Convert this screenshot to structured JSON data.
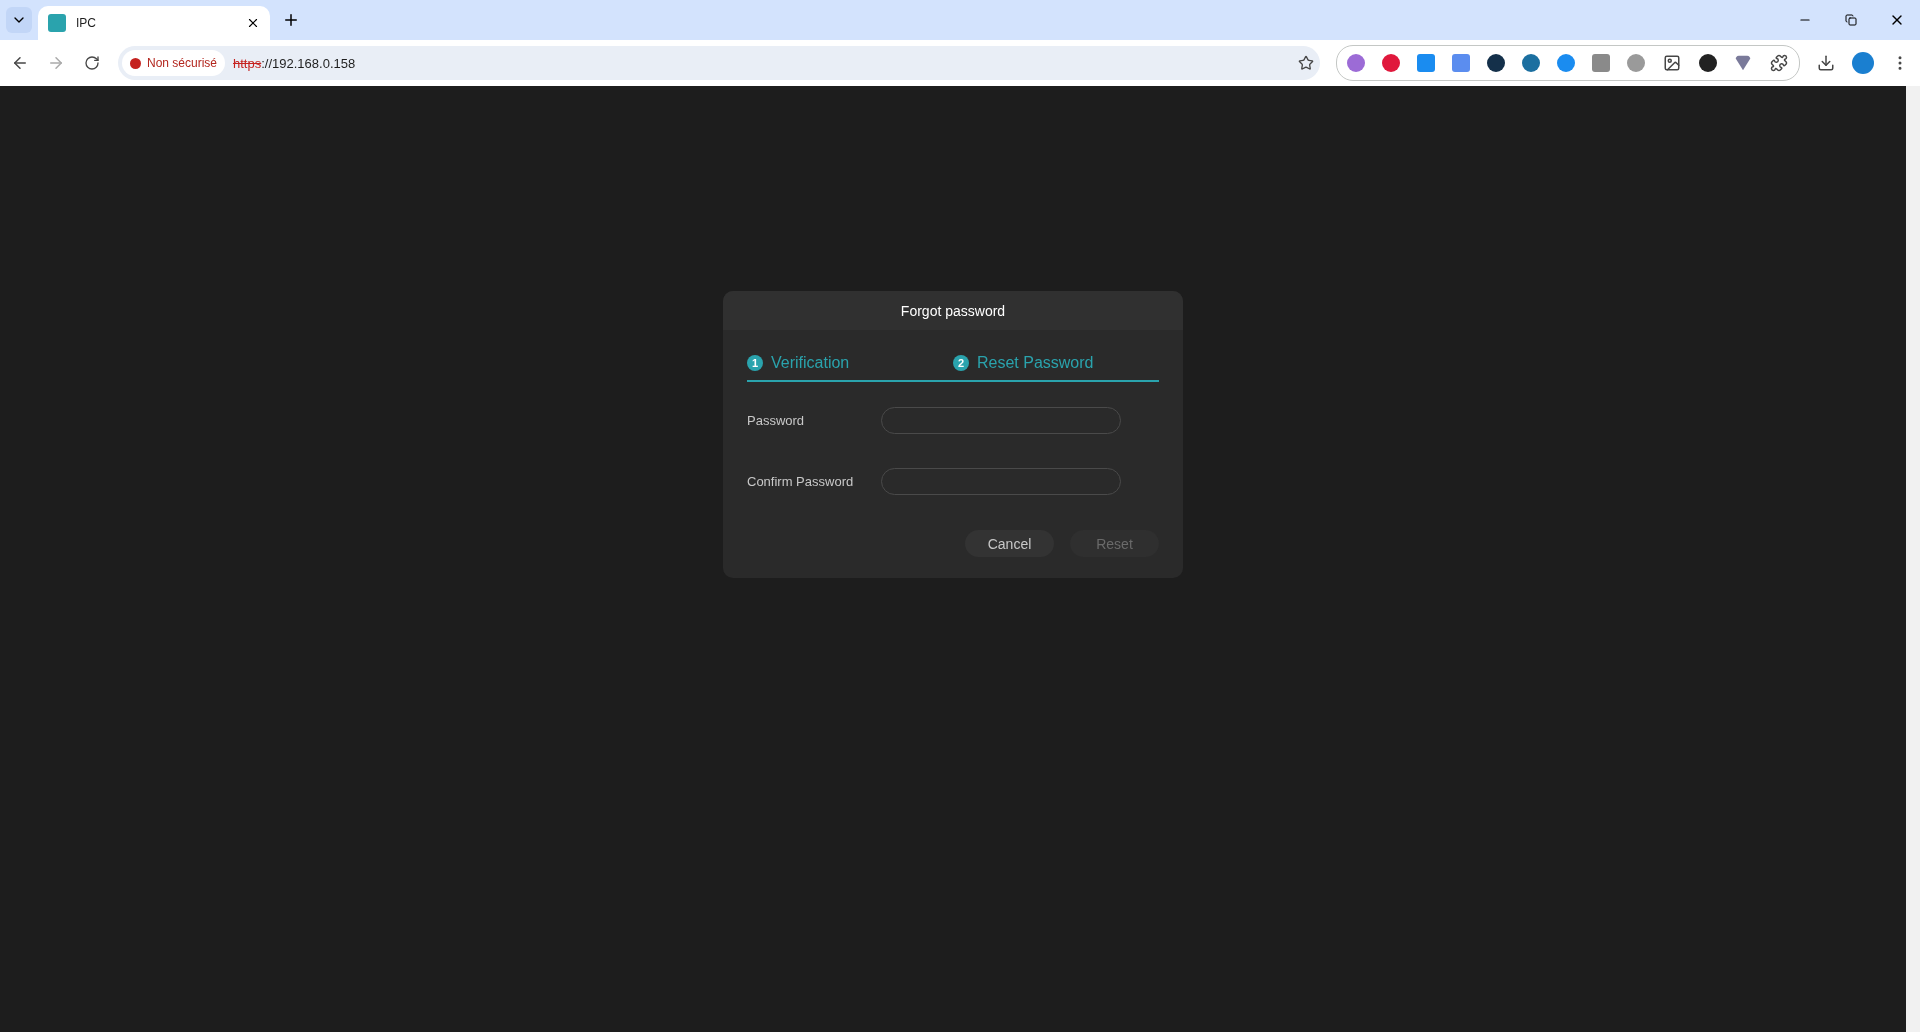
{
  "browser": {
    "tab": {
      "title": "IPC"
    },
    "security": "Non sécurisé",
    "url_scheme": "https",
    "url_rest": "://192.168.0.158"
  },
  "dialog": {
    "title": "Forgot password",
    "steps": [
      {
        "number": "1",
        "label": "Verification"
      },
      {
        "number": "2",
        "label": "Reset Password"
      }
    ],
    "fields": [
      {
        "label": "Password"
      },
      {
        "label": "Confirm Password"
      }
    ],
    "buttons": [
      {
        "label": "Cancel",
        "disabled": false
      },
      {
        "label": "Reset",
        "disabled": true
      }
    ]
  }
}
